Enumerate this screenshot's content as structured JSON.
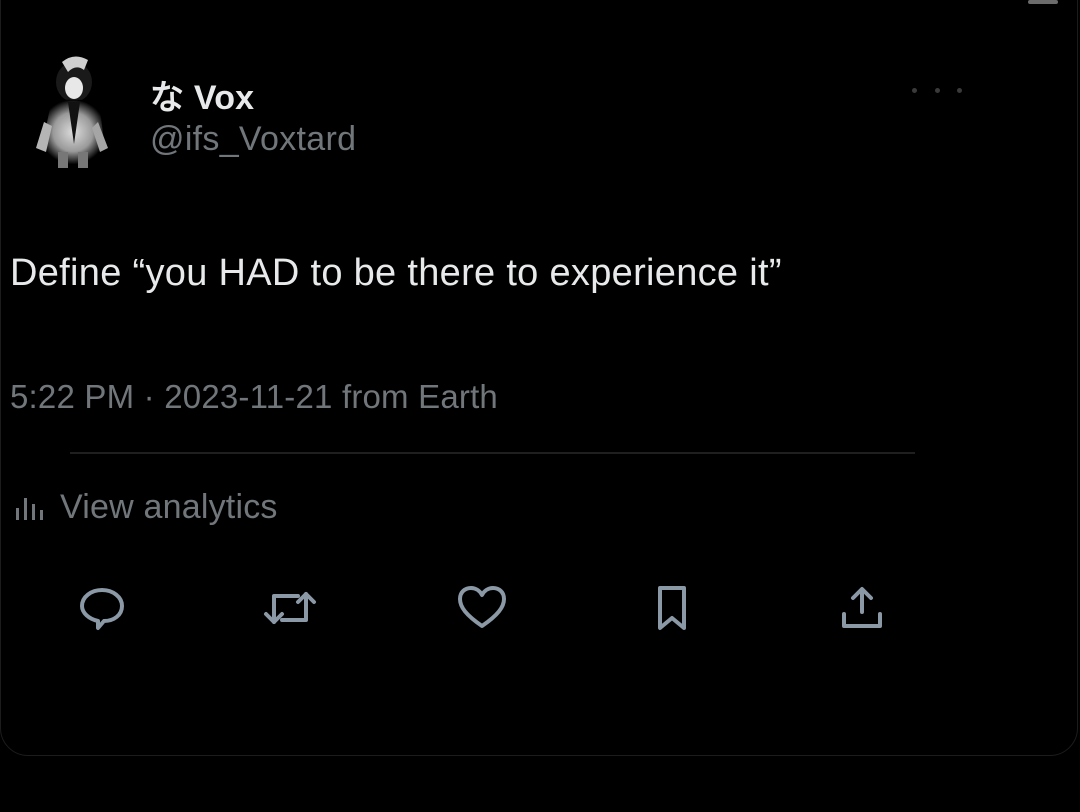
{
  "tweet": {
    "author": {
      "display_name": "な Vox",
      "handle": "@ifs_Voxtard",
      "avatar_icon": "avatar-image"
    },
    "text": "Define “you HAD to be there to experience it”",
    "timestamp": "5:22 PM · 2023-11-21 from Earth",
    "more_icon": "more-options-icon"
  },
  "analytics": {
    "label": "View analytics",
    "icon": "bar-chart-icon"
  },
  "actions": [
    {
      "name": "reply",
      "icon": "reply-icon"
    },
    {
      "name": "retweet",
      "icon": "retweet-icon"
    },
    {
      "name": "like",
      "icon": "heart-icon"
    },
    {
      "name": "bookmark",
      "icon": "bookmark-icon"
    },
    {
      "name": "share",
      "icon": "share-icon"
    }
  ],
  "colors": {
    "background": "#000000",
    "text_primary": "#e7e9ea",
    "text_secondary": "#71767b",
    "icon": "#8b98a5"
  }
}
